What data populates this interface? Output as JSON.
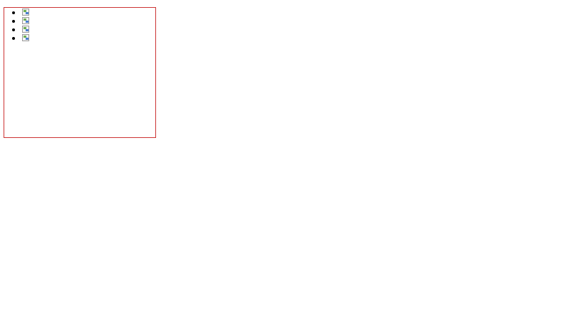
{
  "frame": {
    "border_color": "#cc3333"
  },
  "images": [
    {
      "icon": "broken-image-icon"
    },
    {
      "icon": "broken-image-icon"
    },
    {
      "icon": "broken-image-icon"
    },
    {
      "icon": "broken-image-icon"
    }
  ]
}
